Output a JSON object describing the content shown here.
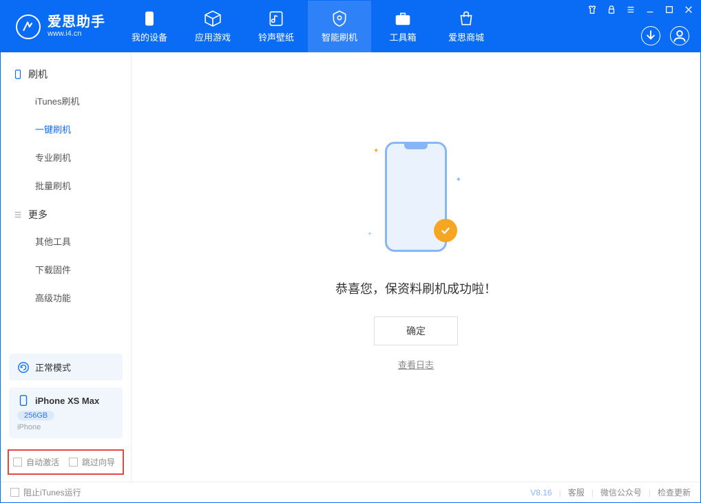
{
  "app": {
    "name_cn": "爱思助手",
    "name_en": "www.i4.cn"
  },
  "tabs": [
    {
      "label": "我的设备"
    },
    {
      "label": "应用游戏"
    },
    {
      "label": "铃声壁纸"
    },
    {
      "label": "智能刷机"
    },
    {
      "label": "工具箱"
    },
    {
      "label": "爱思商城"
    }
  ],
  "sidebar": {
    "section1_title": "刷机",
    "items1": [
      {
        "label": "iTunes刷机"
      },
      {
        "label": "一键刷机"
      },
      {
        "label": "专业刷机"
      },
      {
        "label": "批量刷机"
      }
    ],
    "section2_title": "更多",
    "items2": [
      {
        "label": "其他工具"
      },
      {
        "label": "下载固件"
      },
      {
        "label": "高级功能"
      }
    ]
  },
  "device_status": {
    "mode": "正常模式",
    "model": "iPhone XS Max",
    "storage": "256GB",
    "type": "iPhone"
  },
  "options": {
    "auto_activate": "自动激活",
    "skip_guide": "跳过向导"
  },
  "main": {
    "success_message": "恭喜您，保资料刷机成功啦！",
    "confirm": "确定",
    "view_log": "查看日志"
  },
  "footer": {
    "block_itunes": "阻止iTunes运行",
    "version": "V8.16",
    "links": [
      "客服",
      "微信公众号",
      "检查更新"
    ]
  }
}
